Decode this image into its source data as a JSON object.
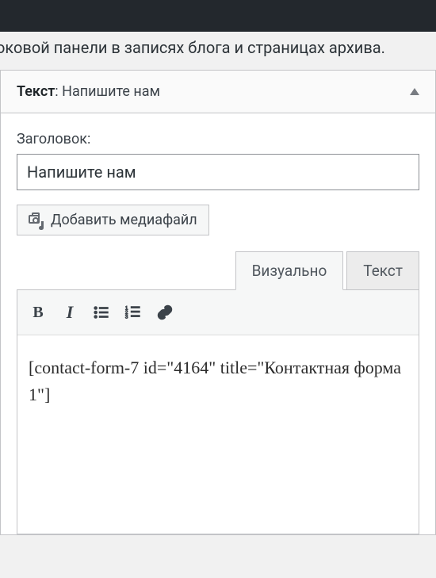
{
  "page": {
    "description_text": "оковой панели в записях блога и страницах архива."
  },
  "widget": {
    "header_prefix": "Текст",
    "header_suffix": ": Напишите нам",
    "title_label": "Заголовок:",
    "title_value": "Напишите нам",
    "media_button_label": "Добавить медиафайл"
  },
  "editor": {
    "tab_visual": "Визуально",
    "tab_text": "Текст",
    "content": "[contact-form-7 id=\"4164\" title=\"Контактная форма 1\"]"
  }
}
